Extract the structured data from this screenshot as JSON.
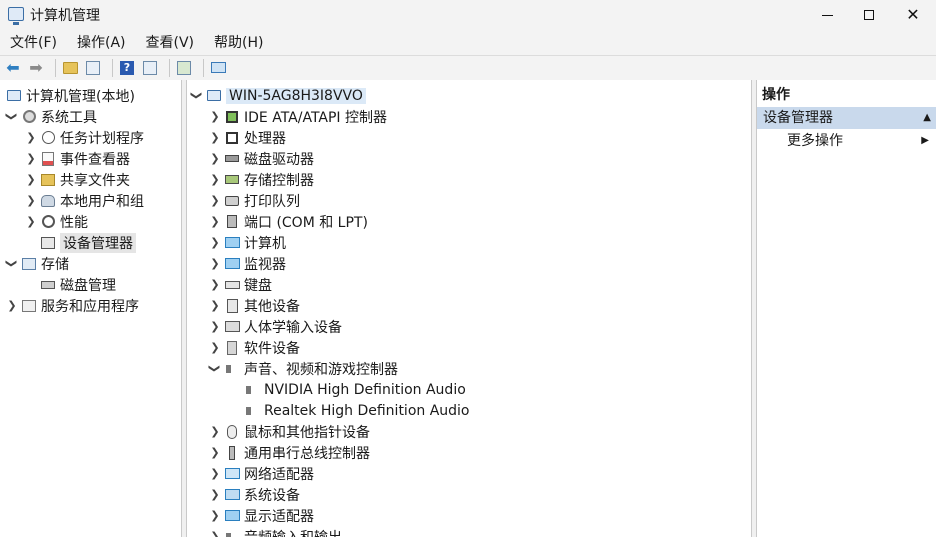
{
  "window": {
    "title": "计算机管理"
  },
  "menu": [
    "文件(F)",
    "操作(A)",
    "查看(V)",
    "帮助(H)"
  ],
  "toolbar": {
    "icons": [
      "back-icon",
      "forward-icon",
      "up-folder-icon",
      "show-hide-tree-icon",
      "help-icon",
      "properties-icon",
      "export-icon",
      "monitor-icon"
    ]
  },
  "left_tree": {
    "root": "计算机管理(本地)",
    "system_tools": "系统工具",
    "task_scheduler": "任务计划程序",
    "event_viewer": "事件查看器",
    "shared_folders": "共享文件夹",
    "local_users": "本地用户和组",
    "performance": "性能",
    "device_manager": "设备管理器",
    "storage": "存储",
    "disk_management": "磁盘管理",
    "services_apps": "服务和应用程序"
  },
  "device_tree": {
    "host": "WIN-5AG8H3I8VVO",
    "categories": [
      "IDE ATA/ATAPI 控制器",
      "处理器",
      "磁盘驱动器",
      "存储控制器",
      "打印队列",
      "端口 (COM 和 LPT)",
      "计算机",
      "监视器",
      "键盘",
      "其他设备",
      "人体学输入设备",
      "软件设备",
      "声音、视频和游戏控制器",
      "鼠标和其他指针设备",
      "通用串行总线控制器",
      "网络适配器",
      "系统设备",
      "显示适配器",
      "音频输入和输出"
    ],
    "sound_children": [
      "NVIDIA High Definition Audio",
      "Realtek High Definition Audio"
    ]
  },
  "actions": {
    "header": "操作",
    "section": "设备管理器",
    "more": "更多操作"
  }
}
